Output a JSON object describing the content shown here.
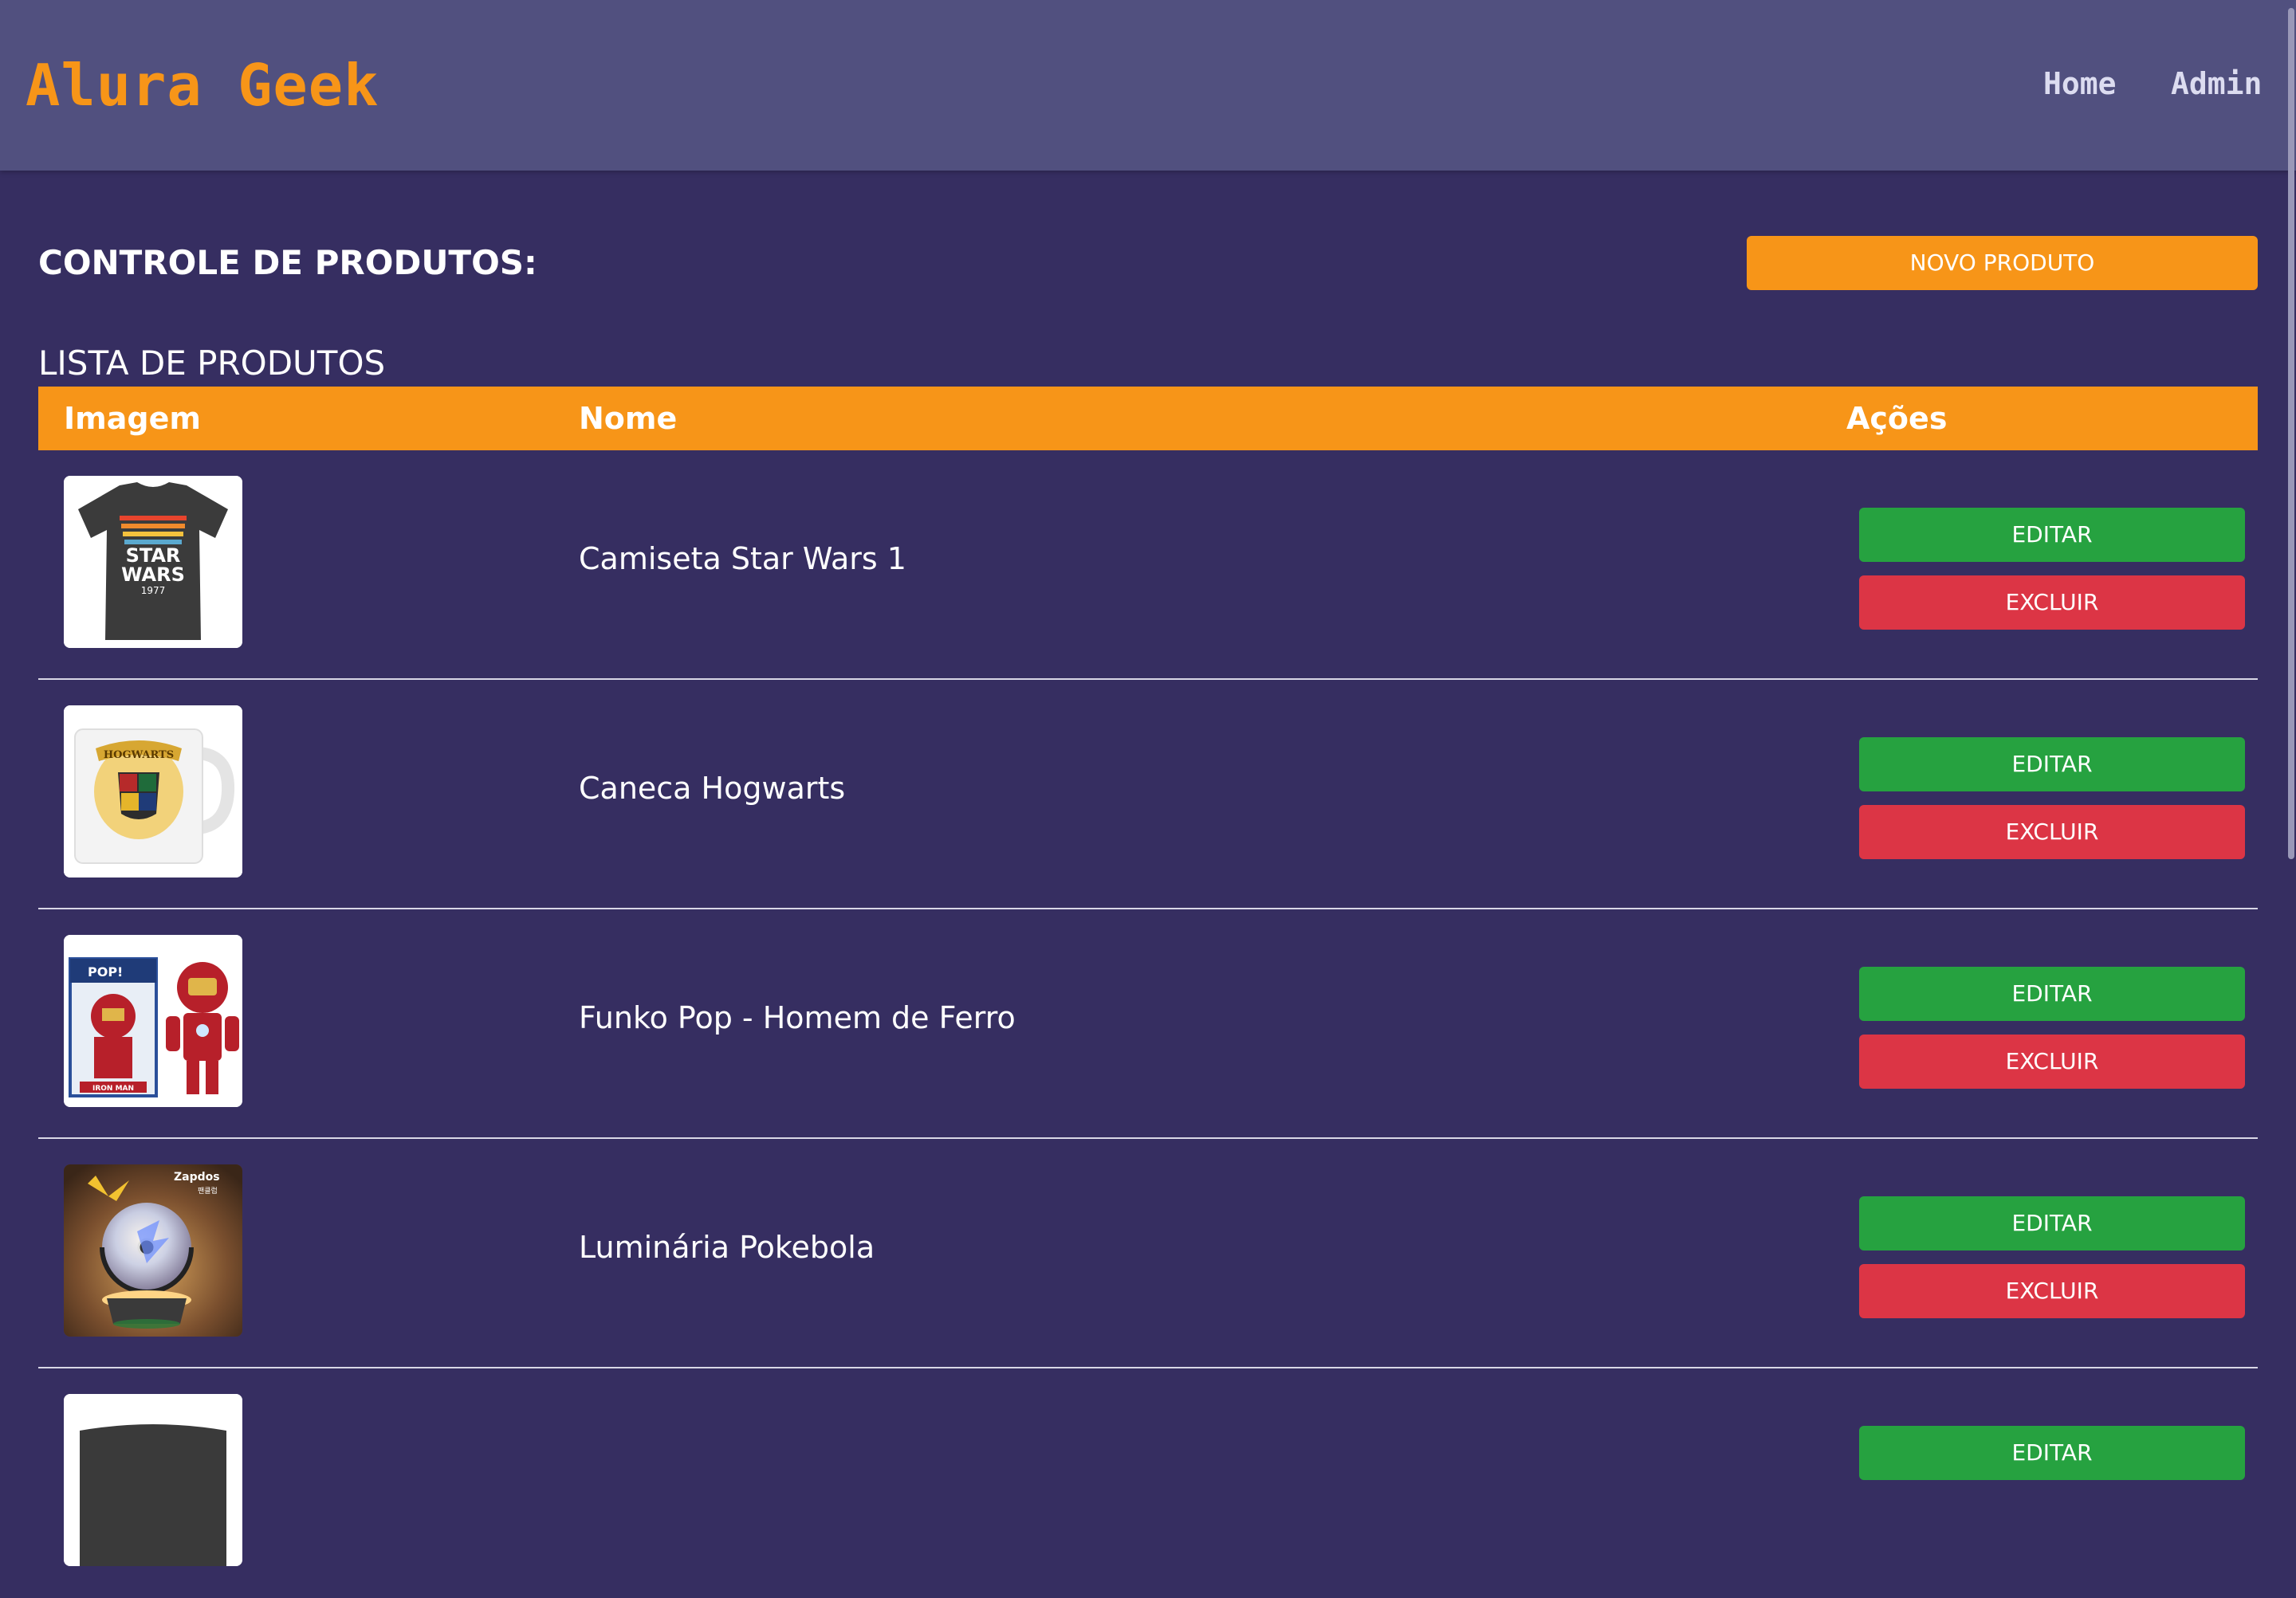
{
  "header": {
    "logo": "Alura Geek",
    "nav": [
      {
        "label": "Home"
      },
      {
        "label": "Admin"
      }
    ]
  },
  "main": {
    "section_title": "CONTROLE DE PRODUTOS:",
    "new_product_label": "NOVO PRODUTO",
    "list_title": "LISTA DE PRODUTOS",
    "columns": [
      "Imagem",
      "Nome",
      "Ações"
    ],
    "actions": {
      "edit": "EDITAR",
      "delete": "EXCLUIR"
    },
    "products": [
      {
        "name": "Camiseta Star Wars 1",
        "image": "star-wars-tshirt"
      },
      {
        "name": "Caneca Hogwarts",
        "image": "hogwarts-mug"
      },
      {
        "name": "Funko Pop - Homem de Ferro",
        "image": "iron-man-funko"
      },
      {
        "name": "Luminária Pokebola",
        "image": "pokeball-lamp"
      },
      {
        "name": "",
        "image": "product-5"
      }
    ]
  },
  "images": {
    "tshirt": {
      "text1": "STAR",
      "text2": "WARS",
      "year": "1977"
    },
    "mug": {
      "text": "HOGWARTS"
    },
    "funko": {
      "brand": "POP!",
      "name": "IRON MAN"
    },
    "lamp": {
      "title": "Zapdos",
      "sub": "팬클럽"
    }
  },
  "colors": {
    "background": "#362e61",
    "header": "#51507f",
    "accent": "#f79518",
    "edit": "#26a240",
    "delete": "#dc3545"
  }
}
